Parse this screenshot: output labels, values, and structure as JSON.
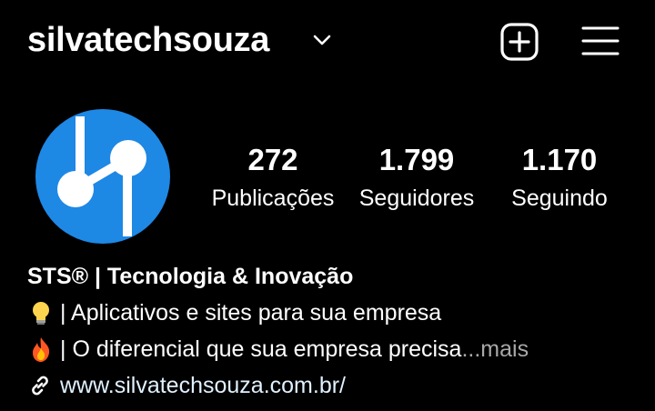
{
  "header": {
    "username": "silvatechsouza",
    "icons": {
      "dropdown": "chevron-down-icon",
      "new_post": "add-square-icon",
      "menu": "hamburger-menu-icon"
    }
  },
  "profile": {
    "avatar": {
      "icon": "logo-avatar",
      "bg_color": "#1e88e5"
    },
    "stats": {
      "posts": {
        "count": "272",
        "label": "Publicações"
      },
      "followers": {
        "count": "1.799",
        "label": "Seguidores"
      },
      "following": {
        "count": "1.170",
        "label": "Seguindo"
      }
    }
  },
  "bio": {
    "name": "STS® | Tecnologia & Inovação",
    "line1": {
      "icon": "lightbulb-emoji",
      "text": "|  Aplicativos e sites para sua empresa"
    },
    "line2": {
      "icon": "fire-emoji",
      "text": "| O diferencial que sua empresa precisa",
      "ellipsis": "...",
      "more": " mais"
    },
    "link": {
      "icon": "link-icon",
      "text": "www.silvatechsouza.com.br/"
    }
  },
  "colors": {
    "background": "#000000",
    "text": "#ffffff",
    "muted": "#a8a8a8",
    "link": "#e0f1ff"
  }
}
